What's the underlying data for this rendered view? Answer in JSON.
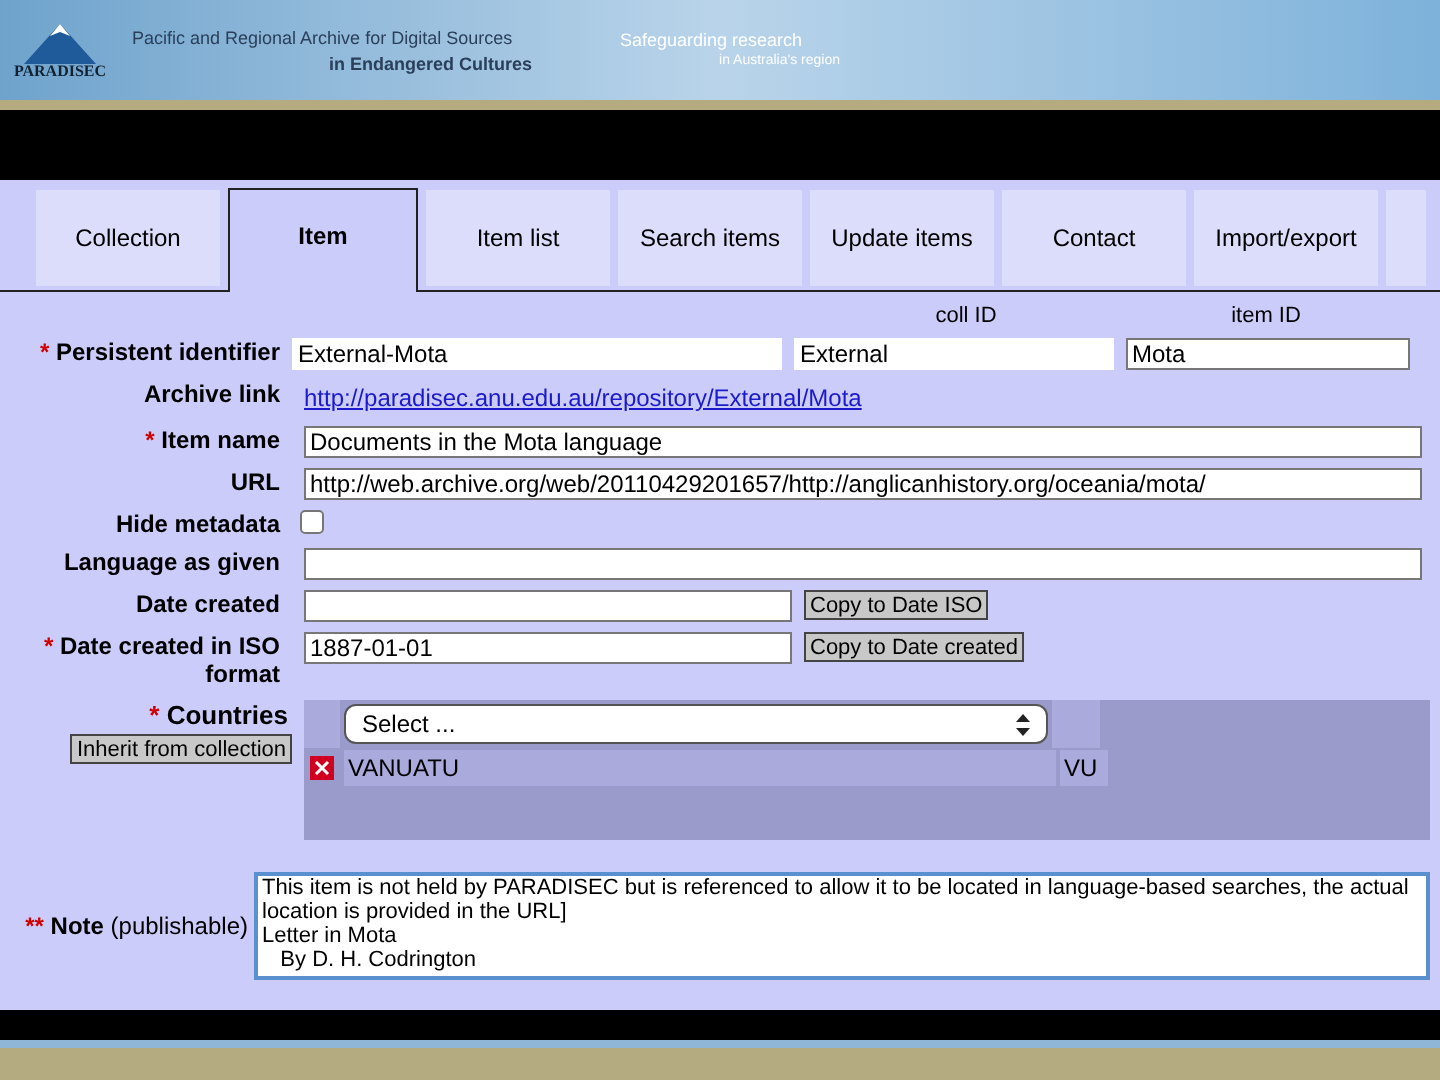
{
  "header": {
    "logo_text": "PARADISEC",
    "title_line1": "Pacific and Regional Archive for Digital Sources",
    "title_line2": "in Endangered Cultures",
    "tagline_line1": "Safeguarding research",
    "tagline_line2": "in Australia's region"
  },
  "tabs": [
    {
      "label": "Collection",
      "selected": false
    },
    {
      "label": "Item",
      "selected": true
    },
    {
      "label": "Item list",
      "selected": false
    },
    {
      "label": "Search items",
      "selected": false
    },
    {
      "label": "Update items",
      "selected": false
    },
    {
      "label": "Contact",
      "selected": false
    },
    {
      "label": "Import/export",
      "selected": false
    }
  ],
  "column_headers": [
    "coll ID",
    "item ID"
  ],
  "fields": [
    {
      "kind": "pid",
      "marker": "*",
      "label": "Persistent identifier",
      "values": [
        "External-Mota",
        "External",
        "Mota"
      ]
    },
    {
      "kind": "link",
      "label": "Archive link",
      "value": "http://paradisec.anu.edu.au/repository/External/Mota"
    },
    {
      "kind": "text",
      "marker": "*",
      "label": "Item name",
      "value": "Documents in the Mota language"
    },
    {
      "kind": "text",
      "label": "URL",
      "value": "http://web.archive.org/web/20110429201657/http://anglicanhistory.org/oceania/mota/"
    },
    {
      "kind": "checkbox",
      "label": "Hide metadata",
      "checked": false
    },
    {
      "kind": "text",
      "label": "Language as given"
    },
    {
      "kind": "date",
      "label": "Date created",
      "button": "Copy to Date ISO"
    },
    {
      "kind": "date",
      "marker": "*",
      "label": "Date created in ISO format",
      "value": "1887-01-01",
      "button": "Copy to Date created"
    }
  ],
  "countries": {
    "marker": "*",
    "label": "Countries",
    "inherit_button": "Inherit from collection",
    "select": "Select ...",
    "rows": [
      {
        "name": "VANUATU",
        "code": "VU"
      }
    ]
  },
  "note": {
    "marker": "**",
    "label": "Note",
    "sublabel": "(publishable)",
    "lines": [
      "This item is not held by PARADISEC but is referenced to allow it to be located in language-based searches, the actual location is provided in the URL]",
      "Letter in Mota",
      "   By D. H. Codrington"
    ]
  }
}
